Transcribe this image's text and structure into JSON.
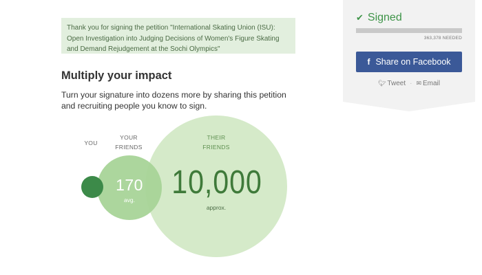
{
  "notice": {
    "text": "Thank you for signing the petition \"International Skating Union (ISU): Open Investigation into Judging Decisions of Women's Figure Skating and Demand Rejudgement at the Sochi Olympics\""
  },
  "impact": {
    "heading": "Multiply your impact",
    "subtext": "Turn your signature into dozens more by sharing this petition and recruiting people you know to sign.",
    "you_label": "YOU",
    "friends_label_1": "YOUR",
    "friends_label_2": "FRIENDS",
    "their_label_1": "THEIR",
    "their_label_2": "FRIENDS",
    "friends_count": "170",
    "friends_note": "avg.",
    "their_count": "10,000",
    "their_note": "approx."
  },
  "sidebar": {
    "status": "Signed",
    "needed": "363,378 NEEDED",
    "progress_fraction": 0.0,
    "facebook_button": "Share on Facebook",
    "tweet_link": "Tweet",
    "email_link": "Email",
    "separator": "·"
  },
  "colors": {
    "accent_green": "#3e9448",
    "facebook_blue": "#3b5998",
    "notice_bg": "#e2efde",
    "panel_bg": "#f2f2f2"
  },
  "icons": [
    "check-icon",
    "facebook-icon",
    "twitter-icon",
    "email-icon"
  ]
}
